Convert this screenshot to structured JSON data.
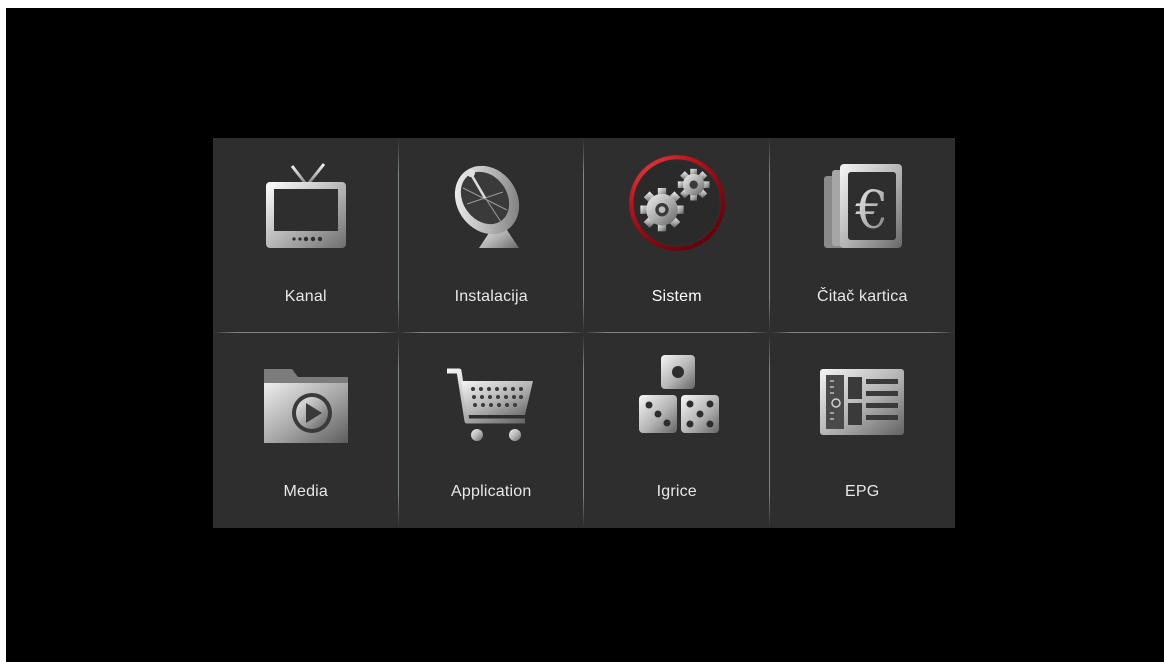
{
  "menu": {
    "items": [
      {
        "label": "Kanal",
        "icon": "tv-icon"
      },
      {
        "label": "Instalacija",
        "icon": "satellite-dish-icon"
      },
      {
        "label": "Sistem",
        "icon": "gears-icon",
        "selected": true
      },
      {
        "label": "Čitač kartica",
        "icon": "card-reader-euro-icon"
      },
      {
        "label": "Media",
        "icon": "media-folder-icon"
      },
      {
        "label": "Application",
        "icon": "shopping-cart-icon"
      },
      {
        "label": "Igrice",
        "icon": "dice-icon"
      },
      {
        "label": "EPG",
        "icon": "epg-guide-icon"
      }
    ]
  },
  "colors": {
    "screen_background": "#000000",
    "panel_background": "#2e2e2e",
    "selection_ring": "#c0141c",
    "label_text": "#e8e8e8"
  }
}
